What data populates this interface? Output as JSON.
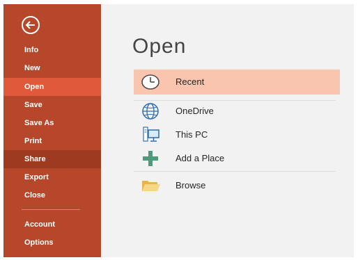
{
  "sidebar": {
    "back_icon": "back-arrow-icon",
    "items": [
      {
        "label": "Info"
      },
      {
        "label": "New"
      },
      {
        "label": "Open"
      },
      {
        "label": "Save"
      },
      {
        "label": "Save As"
      },
      {
        "label": "Print"
      },
      {
        "label": "Share"
      },
      {
        "label": "Export"
      },
      {
        "label": "Close"
      },
      {
        "label": "Account"
      },
      {
        "label": "Options"
      }
    ],
    "active_item": "Open",
    "colors": {
      "background": "#b7472a",
      "active": "#e0593b",
      "pressed": "#9e3a20"
    }
  },
  "main": {
    "title": "Open",
    "locations": [
      {
        "label": "Recent",
        "icon": "clock-icon",
        "selected": true
      },
      {
        "label": "OneDrive",
        "icon": "globe-icon"
      },
      {
        "label": "This PC",
        "icon": "computer-icon"
      },
      {
        "label": "Add a Place",
        "icon": "plus-icon"
      },
      {
        "label": "Browse",
        "icon": "folder-icon"
      }
    ],
    "colors": {
      "selected": "#f9c5ae",
      "plus": "#4e9a7a",
      "globe": "#2b6cb0"
    }
  }
}
